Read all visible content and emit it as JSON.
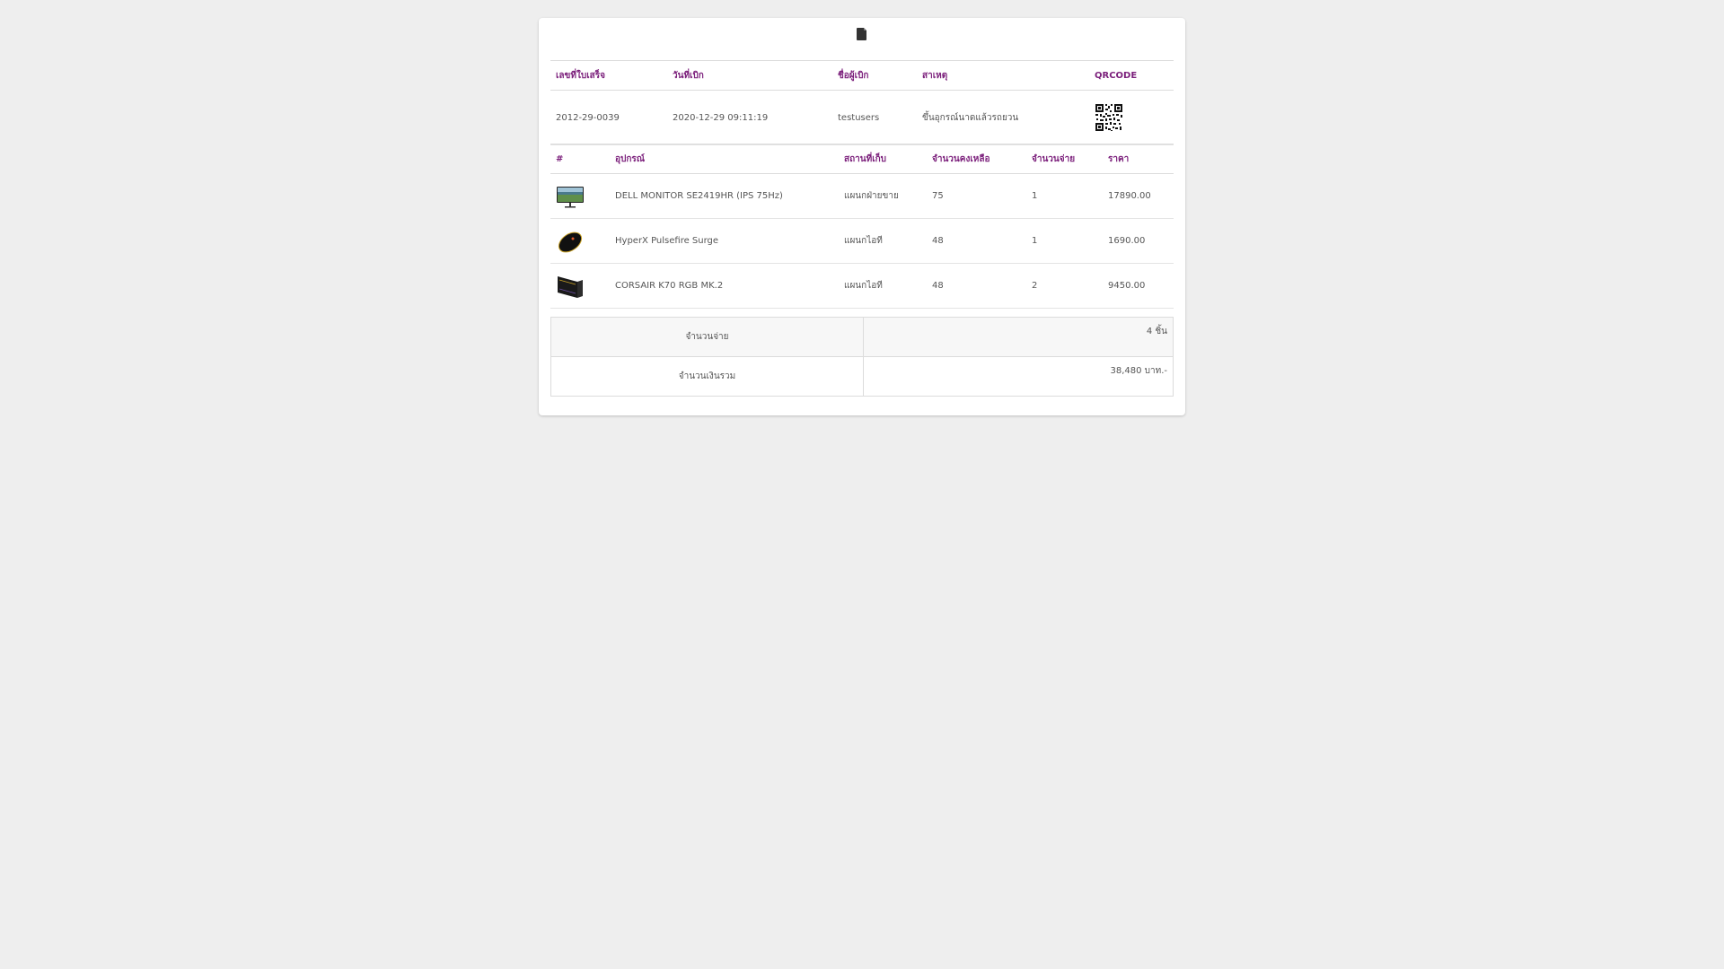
{
  "receipt_header": {
    "icon": "file-icon",
    "columns": [
      "เลขที่ใบเสร็จ",
      "วันที่เบิก",
      "ชื่อผู้เบิก",
      "สาเหตุ",
      "QRCODE"
    ],
    "row": {
      "receipt_no": "2012-29-0039",
      "date": "2020-12-29 09:11:19",
      "requester": "testusers",
      "reason": "ขึ้นอุกรณ์นาดแล้วรถยวน",
      "qr_icon": "qr-code-icon"
    }
  },
  "items": {
    "columns": [
      "#",
      "อุปกรณ์",
      "สถานที่เก็บ",
      "จำนวนคงเหลือ",
      "จำนวนจ่าย",
      "ราคา"
    ],
    "rows": [
      {
        "image": "monitor-image",
        "name": "DELL MONITOR SE2419HR (IPS 75Hz)",
        "location": "แผนกฝ่ายขาย",
        "remaining": "75",
        "paid": "1",
        "price": "17890.00"
      },
      {
        "image": "mouse-image",
        "name": "HyperX Pulsefire Surge",
        "location": "แผนกไอที",
        "remaining": "48",
        "paid": "1",
        "price": "1690.00"
      },
      {
        "image": "keyboard-image",
        "name": "CORSAIR K70 RGB MK.2",
        "location": "แผนกไอที",
        "remaining": "48",
        "paid": "2",
        "price": "9450.00"
      }
    ]
  },
  "summary": {
    "quantity_label": "จำนวนจ่าย",
    "quantity_value": "4 ชิ้น",
    "total_label": "จำนวนเงินรวม",
    "total_value": "38,480 บาท.-"
  },
  "colors": {
    "header_text": "#7b1f7b",
    "background": "#eeeeee",
    "card": "#ffffff"
  }
}
